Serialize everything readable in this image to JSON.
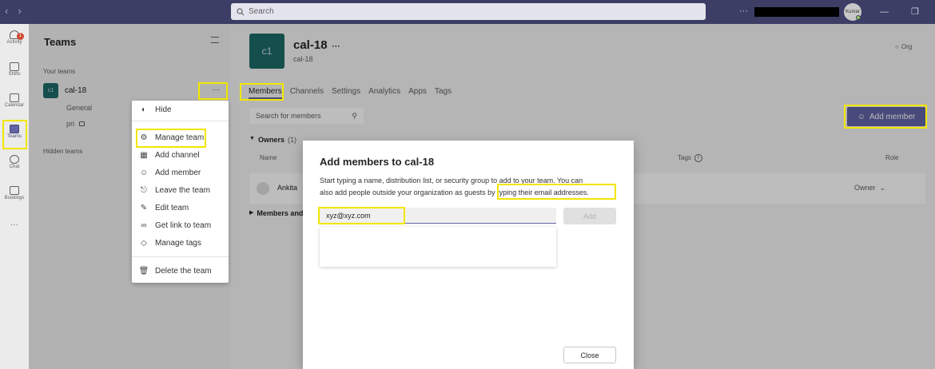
{
  "titlebar": {
    "search_placeholder": "Search",
    "more": "···",
    "avatar_initials": "Kumar"
  },
  "rail": [
    {
      "label": "Activity",
      "badge": "1"
    },
    {
      "label": "Shifts"
    },
    {
      "label": "Calendar"
    },
    {
      "label": "Teams"
    },
    {
      "label": "Chat"
    },
    {
      "label": "Bookings"
    },
    {
      "label": "···"
    }
  ],
  "teams_panel": {
    "title": "Teams",
    "your_teams": "Your teams",
    "team": {
      "tile": "c1",
      "name": "cal-18",
      "more": "···"
    },
    "channels": [
      "General",
      "pri"
    ],
    "hidden_teams": "Hidden teams"
  },
  "context_menu": [
    {
      "label": "Hide",
      "icon": "eye-off-icon"
    },
    {
      "label": "Manage team",
      "icon": "gear-icon"
    },
    {
      "label": "Add channel",
      "icon": "add-channel-icon"
    },
    {
      "label": "Add member",
      "icon": "add-person-icon"
    },
    {
      "label": "Leave the team",
      "icon": "leave-icon"
    },
    {
      "label": "Edit team",
      "icon": "pencil-icon"
    },
    {
      "label": "Get link to team",
      "icon": "link-icon"
    },
    {
      "label": "Manage tags",
      "icon": "tag-icon"
    },
    {
      "label": "Delete the team",
      "icon": "trash-icon"
    }
  ],
  "team_header": {
    "tile": "c1",
    "name": "cal-18",
    "subtitle": "cal-18",
    "more": "···",
    "org": "Org"
  },
  "tabs": [
    "Members",
    "Channels",
    "Settings",
    "Analytics",
    "Apps",
    "Tags"
  ],
  "members": {
    "search_placeholder": "Search for members",
    "add_member": "Add member",
    "owners": "Owners",
    "owners_count": "(1)",
    "col_name": "Name",
    "col_tags": "Tags",
    "col_role": "Role",
    "owner_name": "Ankita",
    "owner_role": "Owner",
    "members_guests": "Members and guests"
  },
  "dialog": {
    "title": "Add members to cal-18",
    "desc_1": "Start typing a name, distribution list, or security group to add to your team. You can",
    "desc_2": "also add people outside your organization as guests",
    "desc_3": "by typing their email addresses.",
    "input_value": "xyz@xyz.com",
    "add_button": "Add",
    "close_button": "Close"
  },
  "colors": {
    "titlebar": "#3d3e66",
    "highlight": "#f2e600",
    "accent": "#6264a7",
    "team_tile": "#1d6b68"
  }
}
